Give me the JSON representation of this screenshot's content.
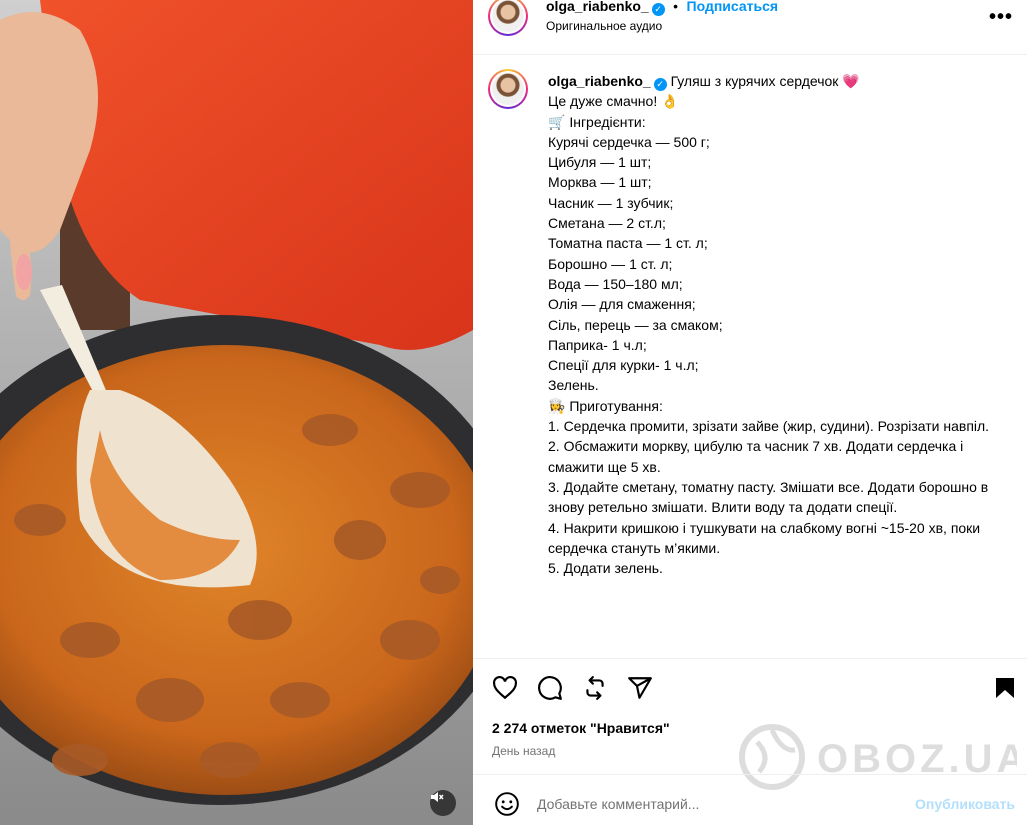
{
  "header": {
    "username": "olga_riabenko_",
    "follow_label": "Подписаться",
    "audio_label": "Оригинальное аудио",
    "more_icon": "more-icon"
  },
  "caption": {
    "username": "olga_riabenko_",
    "title": "Гуляш з курячих сердечок 💗",
    "lines": [
      "Це дуже смачно! 👌",
      "",
      "🛒 Інгредієнти:",
      "Курячі сердечка — 500 г;",
      "Цибуля — 1 шт;",
      "Морква — 1 шт;",
      "Часник — 1 зубчик;",
      "Сметана — 2 ст.л;",
      "Томатна паста — 1 ст. л;",
      "Борошно — 1 ст. л;",
      "Вода — 150–180 мл;",
      "Олія — для смаження;",
      "Сіль, перець — за смаком;",
      "Паприка- 1 ч.л;",
      "Спеції для курки- 1 ч.л;",
      "Зелень.",
      "",
      "👩‍🍳 Приготування:",
      "1. Сердечка промити, зрізати зайве (жир, судини). Розрізати навпіл.",
      "2. Обсмажити моркву, цибулю та часник 7 хв. Додати сердечка і смажити ще 5 хв.",
      "3. Додайте сметану, томатну пасту. Змішати все. Додати борошно в знову ретельно змішати. Влити воду та додати спеції.",
      "4. Накрити кришкою і тушкувати на слабкому вогні ~15-20 хв, поки сердечка стануть м’якими.",
      "5. Додати зелень."
    ]
  },
  "actions": {
    "icons": [
      "like-icon",
      "comment-icon",
      "repost-icon",
      "share-icon",
      "save-icon"
    ],
    "likes_text": "2 274 отметок \"Нравится\"",
    "time_text": "День назад"
  },
  "comment": {
    "placeholder": "Добавьте комментарий...",
    "post_label": "Опубликовать"
  },
  "watermark": {
    "text": "OBOZ.UA"
  },
  "colors": {
    "accent": "#0095f6",
    "post_disabled": "#b2dffc",
    "sweater": "#e8401c",
    "sauce": "#d9771f"
  }
}
